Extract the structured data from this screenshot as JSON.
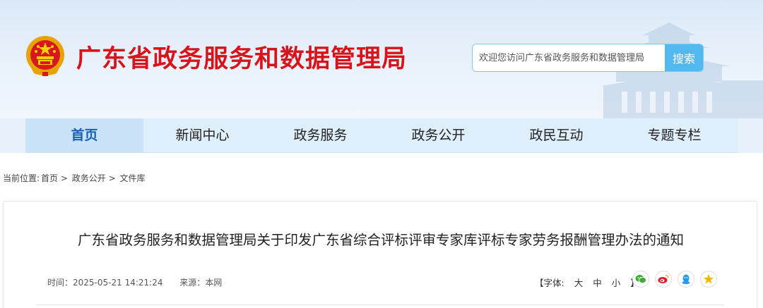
{
  "header": {
    "site_title": "广东省政务服务和数据管理局",
    "emblem_icon": "national-emblem-icon",
    "search": {
      "placeholder": "欢迎您访问广东省政务服务和数据管理局",
      "button_label": "搜索"
    }
  },
  "nav": {
    "items": [
      {
        "label": "首页",
        "active": true
      },
      {
        "label": "新闻中心",
        "active": false
      },
      {
        "label": "政务服务",
        "active": false
      },
      {
        "label": "政务公开",
        "active": false
      },
      {
        "label": "政民互动",
        "active": false
      },
      {
        "label": "专题专栏",
        "active": false
      }
    ]
  },
  "breadcrumb": {
    "prefix": "当前位置:",
    "items": [
      "首页",
      "政务公开",
      "文件库"
    ],
    "separator": " > "
  },
  "article": {
    "title": "广东省政务服务和数据管理局关于印发广东省综合评标评审专家库评标专家劳务报酬管理办法的通知",
    "time_label": "时间：",
    "time_value": "2025-05-21 14:21:24",
    "source_label": "来源：",
    "source_value": "本网",
    "fontsize": {
      "open": "【字体:",
      "large": "大",
      "medium": "中",
      "small": "小",
      "close": "】"
    },
    "share_icons": [
      "wechat-icon",
      "weibo-icon",
      "qq-icon",
      "qzone-icon"
    ]
  },
  "colors": {
    "title_red": "#d8141b",
    "search_blue": "#52b8f0",
    "nav_bg": "#deeefb",
    "nav_active": "#c9e2f8",
    "wechat": "#3cb034",
    "weibo": "#e6162d",
    "qq": "#2b9ae8",
    "qzone": "#f5b400"
  }
}
